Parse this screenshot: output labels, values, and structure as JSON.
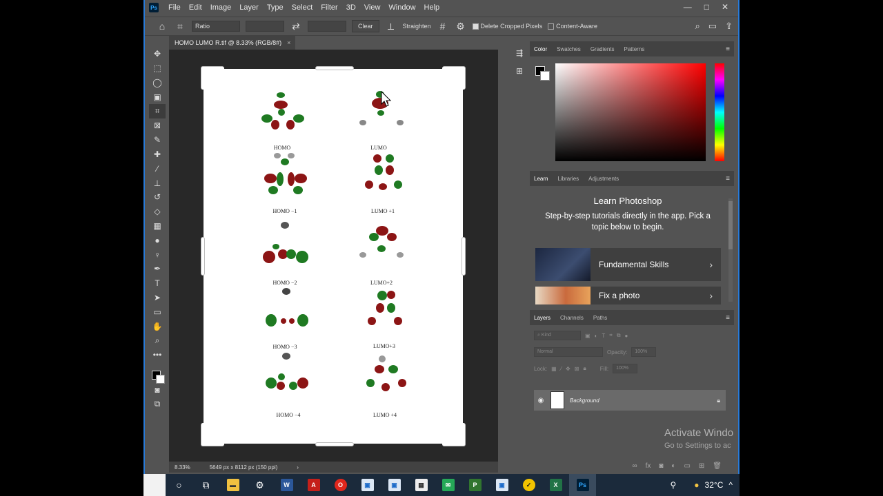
{
  "app": {
    "logo": "Ps"
  },
  "menu": [
    "File",
    "Edit",
    "Image",
    "Layer",
    "Type",
    "Select",
    "Filter",
    "3D",
    "View",
    "Window",
    "Help"
  ],
  "window_controls": {
    "minimize": "—",
    "maximize": "□",
    "close": "✕"
  },
  "options_bar": {
    "ratio_label": "Ratio",
    "clear_label": "Clear",
    "straighten_label": "Straighten",
    "delete_cropped_label": "Delete Cropped Pixels",
    "content_aware_label": "Content-Aware"
  },
  "document": {
    "tab_title": "HOMO LUMO R.tif @ 8.33% (RGB/8#)",
    "close": "×"
  },
  "status": {
    "zoom": "8.33%",
    "dimensions": "5649 px x 8112 px (150 ppi)"
  },
  "figure_labels": {
    "r1l": "HOMO",
    "r1r": "LUMO",
    "r2l": "HOMO −1",
    "r2r": "LUMO +1",
    "r3l": "HOMO −2",
    "r3r": "LUMO+2",
    "r4l": "HOMO −3",
    "r4r": "LUMO+3",
    "r5l": "HOMO −4",
    "r5r": "LUMO +4"
  },
  "color_panel": {
    "tabs": [
      "Color",
      "Swatches",
      "Gradients",
      "Patterns"
    ]
  },
  "learn_panel": {
    "tabs": [
      "Learn",
      "Libraries",
      "Adjustments"
    ],
    "title": "Learn Photoshop",
    "subtitle": "Step-by-step tutorials directly in the app. Pick a topic below to begin.",
    "cards": [
      "Fundamental Skills",
      "Fix a photo"
    ]
  },
  "layers_panel": {
    "tabs": [
      "Layers",
      "Channels",
      "Paths"
    ],
    "kind": "Kind",
    "blend_mode": "Normal",
    "opacity_label": "Opacity:",
    "opacity_value": "100%",
    "lock_label": "Lock:",
    "fill_label": "Fill:",
    "fill_value": "100%",
    "layer_name": "Background"
  },
  "watermark": {
    "line1": "Activate Windo",
    "line2": "Go to Settings to ac"
  },
  "taskbar": {
    "temperature": "32°C"
  }
}
